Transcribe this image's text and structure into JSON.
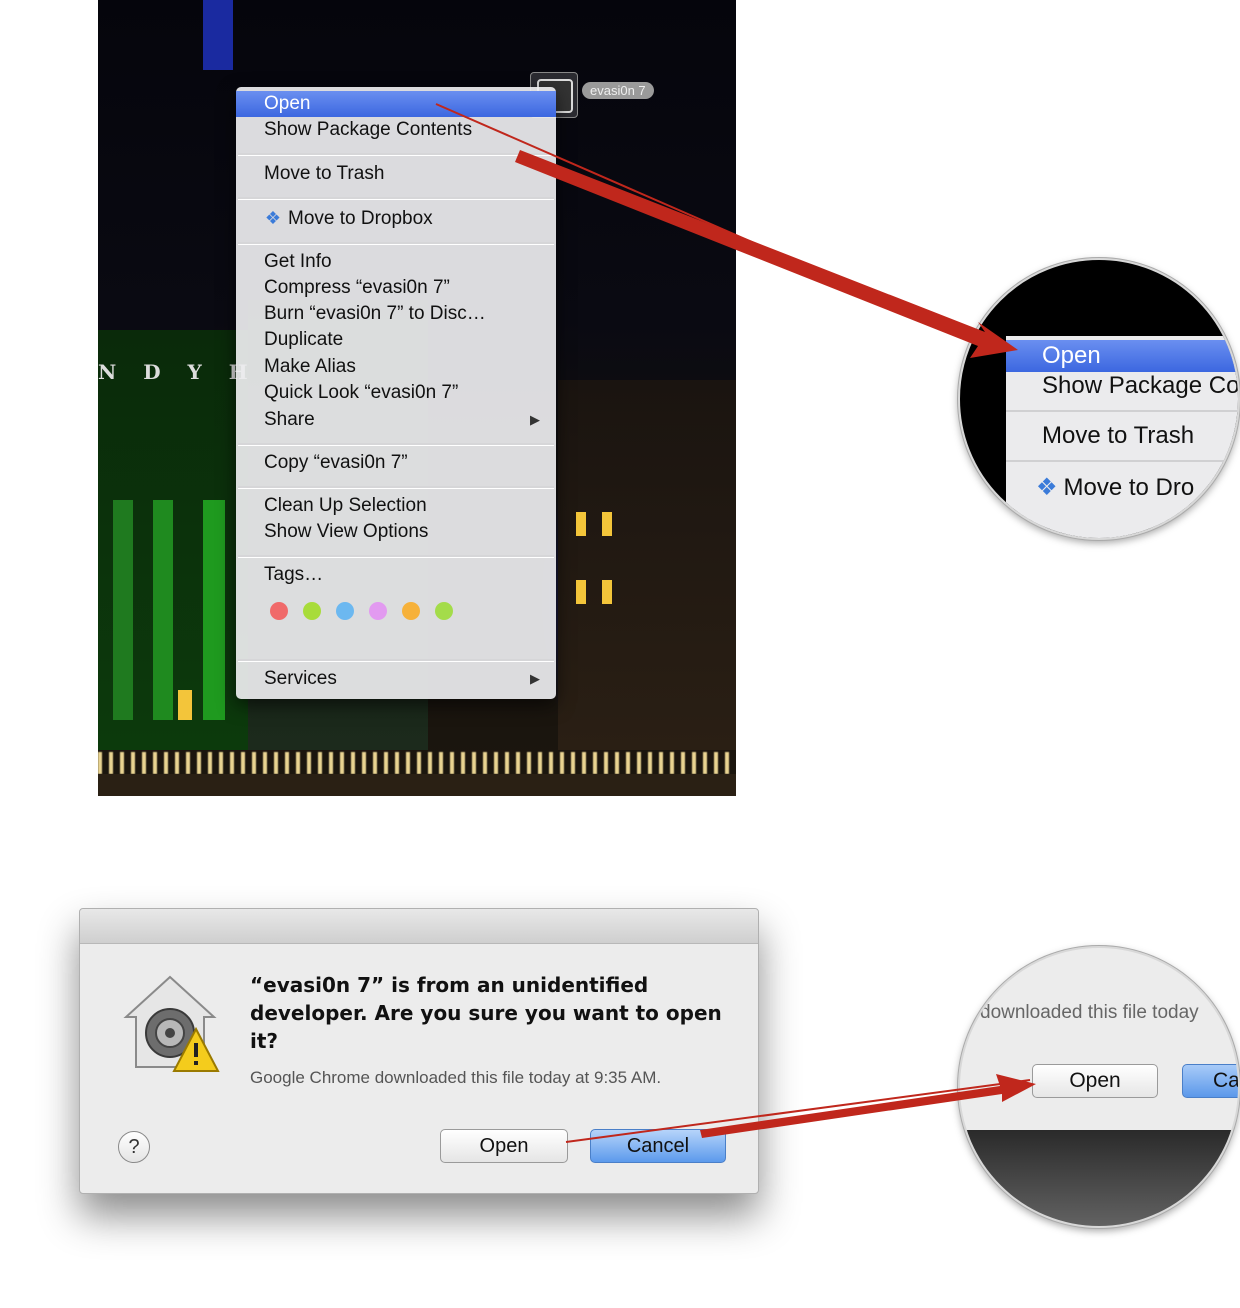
{
  "desktop": {
    "file_label": "evasi0n 7",
    "sign_text": "N D Y H"
  },
  "context_menu": {
    "items": [
      {
        "label": "Open"
      },
      {
        "label": "Show Package Contents"
      },
      {
        "label": "Move to Trash"
      },
      {
        "label": "Move to Dropbox"
      },
      {
        "label": "Get Info"
      },
      {
        "label": "Compress “evasi0n 7”"
      },
      {
        "label": "Burn “evasi0n 7” to Disc…"
      },
      {
        "label": "Duplicate"
      },
      {
        "label": "Make Alias"
      },
      {
        "label": "Quick Look “evasi0n 7”"
      },
      {
        "label": "Share"
      },
      {
        "label": "Copy “evasi0n 7”"
      },
      {
        "label": "Clean Up Selection"
      },
      {
        "label": "Show View Options"
      },
      {
        "label": "Tags…"
      },
      {
        "label": "Services"
      }
    ],
    "tag_colors": [
      "#f06a6a",
      "#a8dc3a",
      "#6cb8f0",
      "#e29af0",
      "#f6b13a",
      "#a4dc4a"
    ],
    "highlight_color": "#3c67e0"
  },
  "zoom_menu": {
    "items": [
      "Open",
      "Show Package Co",
      "Move to Trash",
      "Move to Dro"
    ]
  },
  "dialog": {
    "message": "“evasi0n 7” is from an unidentified developer. Are you sure you want to open it?",
    "info": "Google Chrome downloaded this file today at 9:35 AM.",
    "open_label": "Open",
    "cancel_label": "Cancel",
    "help_label": "?"
  },
  "zoom_dialog": {
    "text": "downloaded this file today",
    "open_label": "Open",
    "partial_label": "Ca"
  },
  "annotation": {
    "arrow_color": "#c0271c"
  }
}
